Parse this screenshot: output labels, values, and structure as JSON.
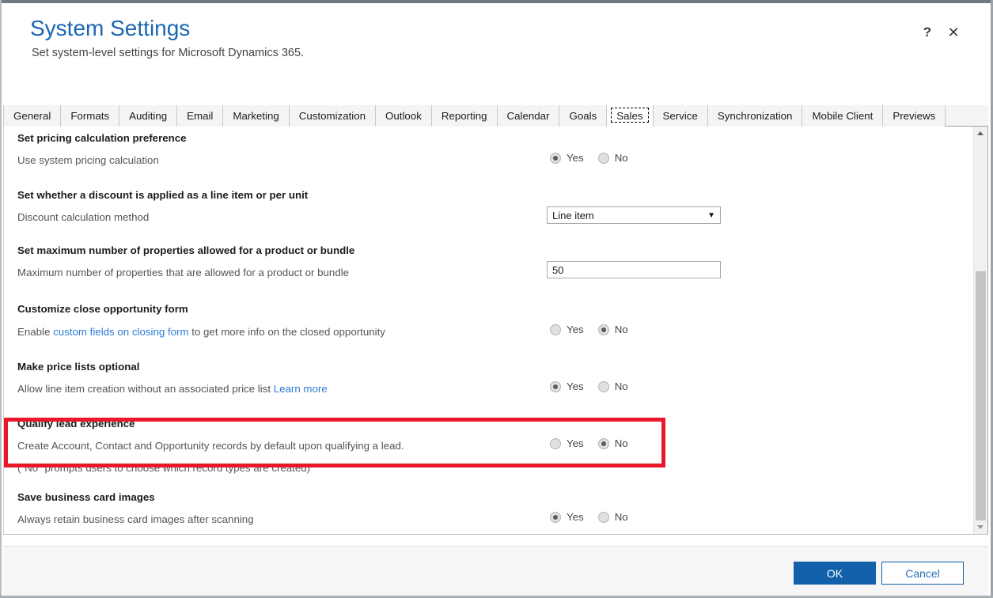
{
  "window": {
    "title": "System Settings",
    "subtitle": "Set system-level settings for Microsoft Dynamics 365.",
    "help_icon": "?",
    "close_icon": "✕",
    "accent_color": "#1a66b3",
    "highlight_color": "#e8172a"
  },
  "tabs": [
    {
      "label": "General",
      "active": false
    },
    {
      "label": "Formats",
      "active": false
    },
    {
      "label": "Auditing",
      "active": false
    },
    {
      "label": "Email",
      "active": false
    },
    {
      "label": "Marketing",
      "active": false
    },
    {
      "label": "Customization",
      "active": false
    },
    {
      "label": "Outlook",
      "active": false
    },
    {
      "label": "Reporting",
      "active": false
    },
    {
      "label": "Calendar",
      "active": false
    },
    {
      "label": "Goals",
      "active": false
    },
    {
      "label": "Sales",
      "active": true
    },
    {
      "label": "Service",
      "active": false
    },
    {
      "label": "Synchronization",
      "active": false
    },
    {
      "label": "Mobile Client",
      "active": false
    },
    {
      "label": "Previews",
      "active": false
    }
  ],
  "sections": [
    {
      "title": "Set pricing calculation preference",
      "description": "Use system pricing calculation",
      "control": "radio",
      "yes_label": "Yes",
      "no_label": "No",
      "selected": "Yes"
    },
    {
      "title": "Set whether a discount is applied as a line item or per unit",
      "description": "Discount calculation method",
      "control": "select",
      "value": "Line item",
      "caret": "▼"
    },
    {
      "title": "Set maximum number of properties allowed for a product or bundle",
      "description": "Maximum number of properties that are allowed for a product or bundle",
      "control": "text",
      "value": "50"
    },
    {
      "title": "Customize close opportunity form",
      "description_before": "Enable ",
      "description_link": "custom fields on closing form",
      "description_after": " to get more info on the closed opportunity",
      "control": "radio",
      "yes_label": "Yes",
      "no_label": "No",
      "selected": "No",
      "highlighted": true
    },
    {
      "title": "Make price lists optional",
      "description_before": "Allow line item creation without an associated price list ",
      "description_link": "Learn more",
      "description_after": "",
      "control": "radio",
      "yes_label": "Yes",
      "no_label": "No",
      "selected": "Yes"
    },
    {
      "title": "Qualify lead experience",
      "description": "Create Account, Contact and Opportunity records by default upon qualifying a lead.",
      "description_2": "(\"No\" prompts users to choose which record types are created)",
      "control": "radio",
      "yes_label": "Yes",
      "no_label": "No",
      "selected": "No"
    },
    {
      "title": "Save business card images",
      "description": "Always retain business card images after scanning",
      "control": "radio",
      "yes_label": "Yes",
      "no_label": "No",
      "selected": "Yes"
    }
  ],
  "scrollbar": {
    "up_arrow": "▲",
    "down_arrow": "▼"
  },
  "footer": {
    "ok_label": "OK",
    "cancel_label": "Cancel"
  }
}
